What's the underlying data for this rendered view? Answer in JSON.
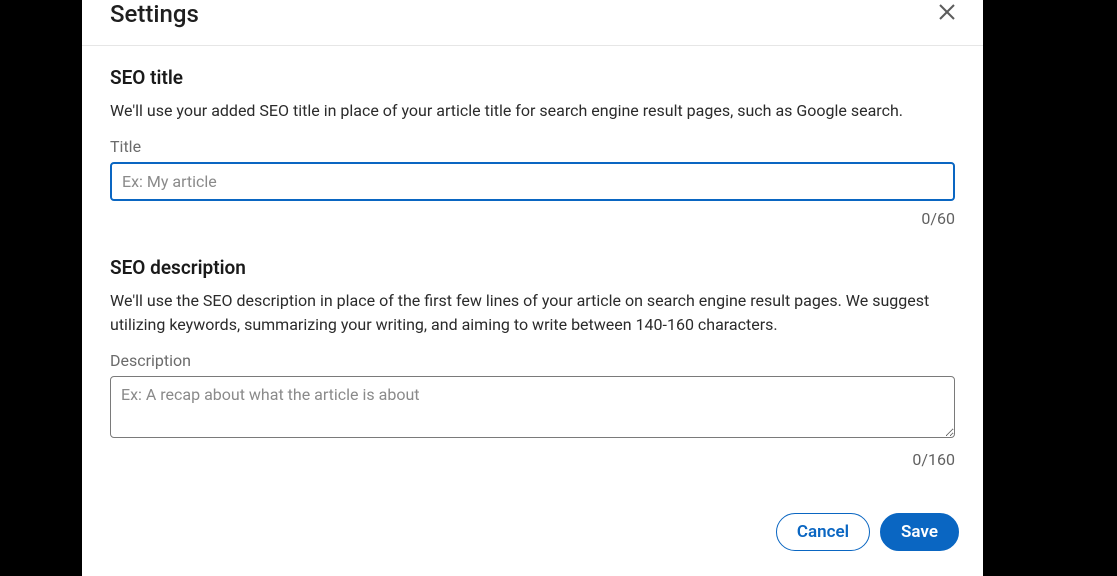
{
  "modal": {
    "title": "Settings",
    "close_label": "Close",
    "sections": {
      "seo_title": {
        "heading": "SEO title",
        "description": "We'll use your added SEO title in place of your article title for search engine result pages, such as Google search.",
        "field_label": "Title",
        "placeholder": "Ex: My article",
        "value": "",
        "counter": "0/60"
      },
      "seo_description": {
        "heading": "SEO description",
        "description": "We'll use the SEO description in place of the first few lines of your article on search engine result pages. We suggest utilizing keywords, summarizing your writing, and aiming to write between 140-160 characters.",
        "field_label": "Description",
        "placeholder": "Ex: A recap about what the article is about",
        "value": "",
        "counter": "0/160"
      }
    },
    "footer": {
      "cancel_label": "Cancel",
      "save_label": "Save"
    }
  }
}
